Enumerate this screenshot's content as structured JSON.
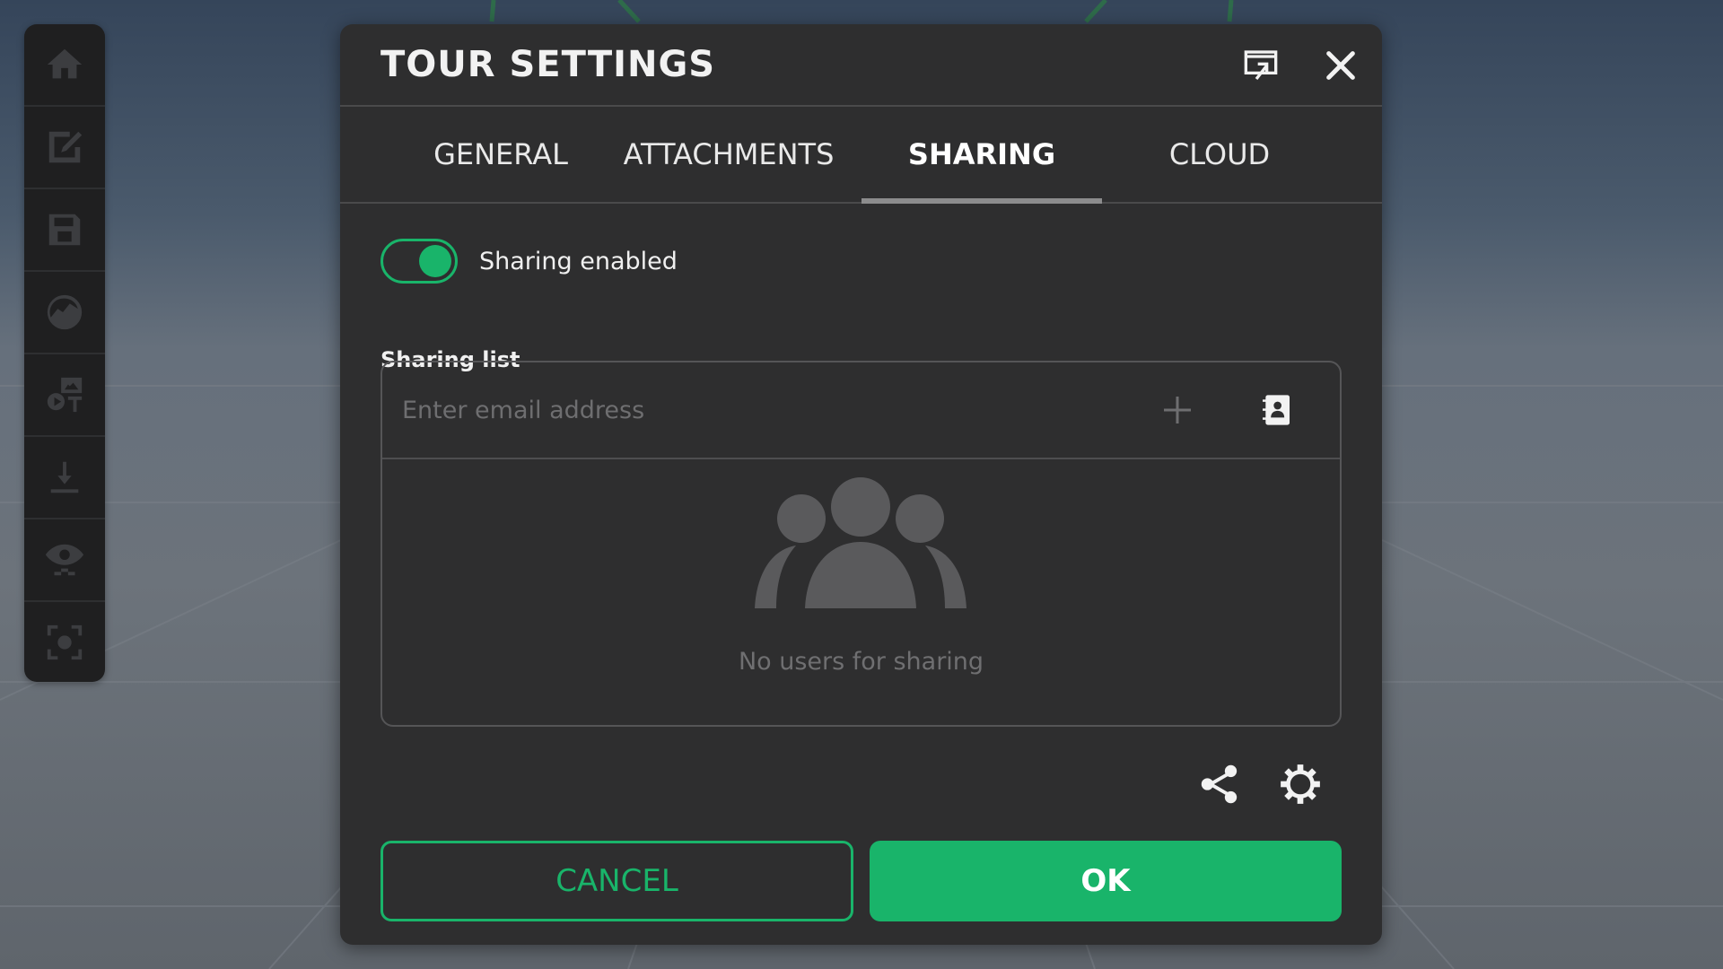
{
  "dialog": {
    "title": "TOUR SETTINGS",
    "header_icons": [
      "popout-window-icon",
      "close-icon"
    ]
  },
  "toolbar": {
    "items": [
      "home-icon",
      "edit-icon",
      "save-icon",
      "panorama-icon",
      "media-text-icon",
      "download-icon",
      "visibility-icon",
      "capture-icon"
    ]
  },
  "tabs": [
    {
      "label": "GENERAL",
      "active": false
    },
    {
      "label": "ATTACHMENTS",
      "active": false
    },
    {
      "label": "SHARING",
      "active": true
    },
    {
      "label": "CLOUD",
      "active": false
    }
  ],
  "sharing": {
    "toggle_label": "Sharing enabled",
    "enabled": true,
    "list_label": "Sharing list",
    "email_placeholder": "Enter email address",
    "email_value": "",
    "empty_text": "No users for sharing"
  },
  "actions": {
    "cancel_label": "CANCEL",
    "ok_label": "OK"
  },
  "colors": {
    "accent": "#19b46a",
    "dialog_bg": "#2e2e2f",
    "toolbar_bg": "#1f1f20"
  }
}
